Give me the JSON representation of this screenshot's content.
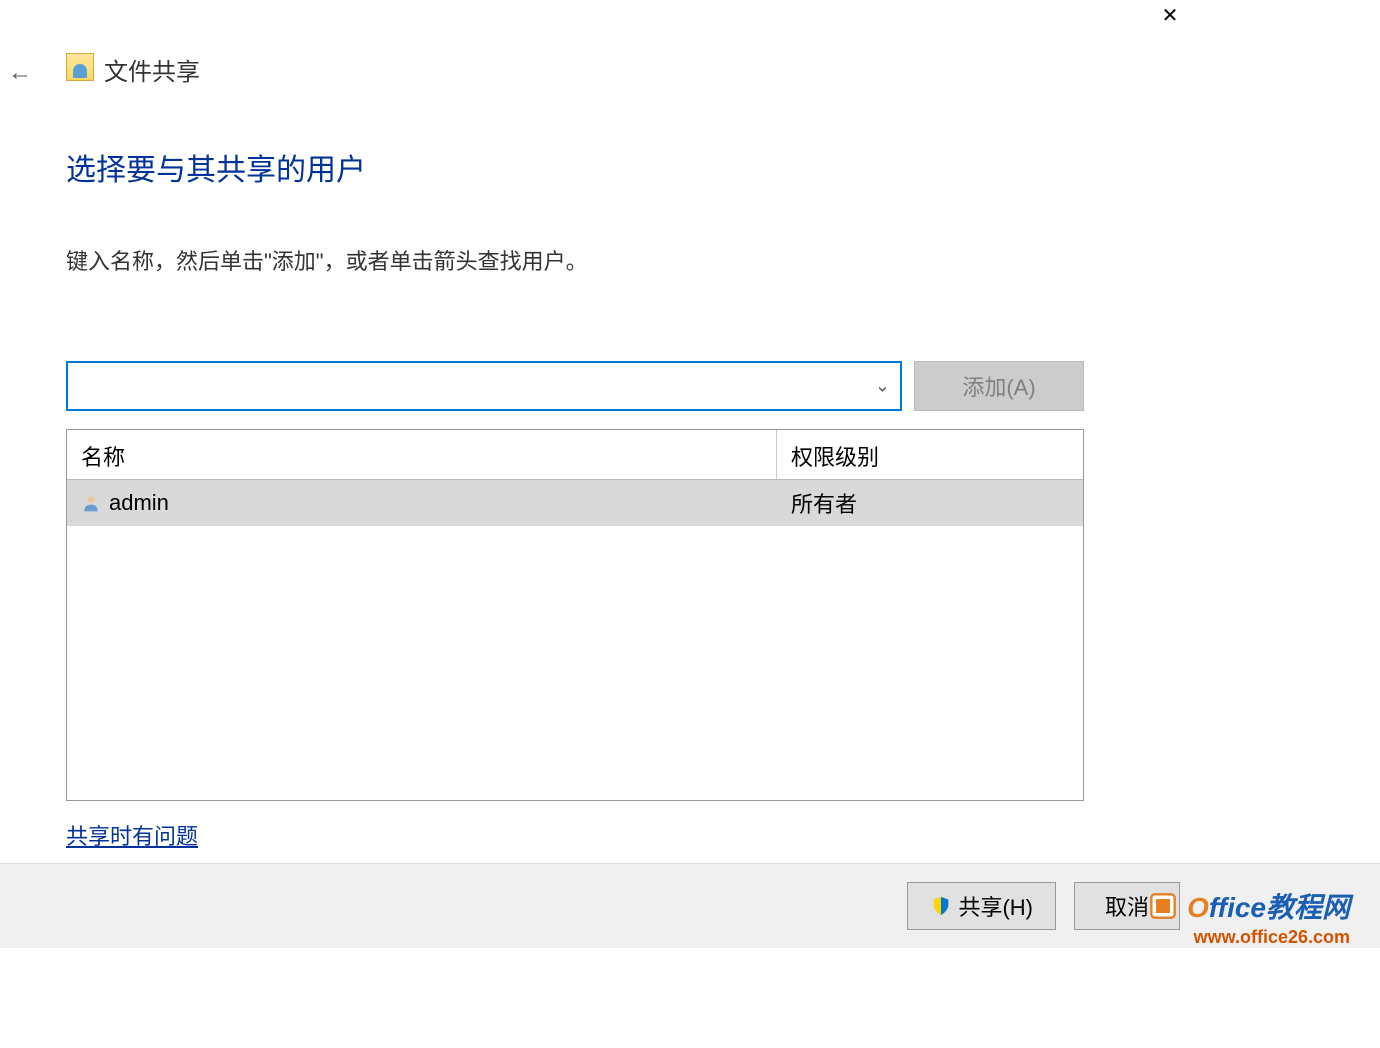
{
  "window": {
    "title": "文件共享"
  },
  "page": {
    "heading": "选择要与其共享的用户",
    "instruction": "键入名称，然后单击\"添加\"，或者单击箭头查找用户。"
  },
  "input": {
    "value": "",
    "add_button": "添加(A)"
  },
  "table": {
    "col_name": "名称",
    "col_permission": "权限级别",
    "rows": [
      {
        "name": "admin",
        "permission": "所有者"
      }
    ]
  },
  "help_link": "共享时有问题",
  "footer": {
    "share_button": "共享(H)",
    "cancel_button": "取消"
  },
  "watermark": {
    "line1_o": "O",
    "line1_rest": "ffice教程网",
    "line2": "www.office26.com"
  }
}
